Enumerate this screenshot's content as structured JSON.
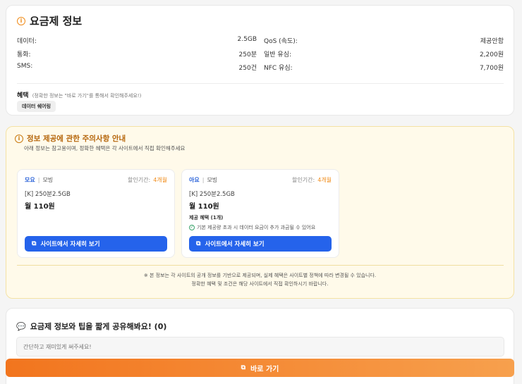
{
  "plan": {
    "title": "요금제 정보",
    "rows": [
      {
        "label": "데이터:",
        "value": "2.5GB"
      },
      {
        "label": "QoS (속도):",
        "value": "제공안함"
      },
      {
        "label": "통화:",
        "value": "250분"
      },
      {
        "label": "일반 유심:",
        "value": "2,200원"
      },
      {
        "label": "SMS:",
        "value": "250건"
      },
      {
        "label": "NFC 유심:",
        "value": "7,700원"
      }
    ],
    "benefit_label": "혜택",
    "benefit_note": "(정확한 정보는 \"바로 가기\"를 통해서 확인해주세요!)",
    "tag": "데이터 쉐어링"
  },
  "notice": {
    "title": "정보 제공에 관한 주의사항 안내",
    "subtitle": "아래 정보는 참고용이며, 정확한 혜택은 각 사이트에서 직접 확인해주세요",
    "offers": [
      {
        "brand": "모요",
        "network": "모빙",
        "discount_label": "할인기간:",
        "discount_value": "4개월",
        "name": "[K] 250분2.5GB",
        "price": "월 110원",
        "benefits_label": "",
        "benefit_item": "",
        "button": "사이트에서 자세히 보기"
      },
      {
        "brand": "아요",
        "network": "모빙",
        "discount_label": "할인기간:",
        "discount_value": "4개월",
        "name": "[K] 250분2.5GB",
        "price": "월 110원",
        "benefits_label": "제공 혜택 (1개)",
        "benefit_item": "기본 제공량 초과 시 데이터 요금이 추가 과금될 수 있어요",
        "button": "사이트에서 자세히 보기"
      }
    ],
    "footer_line1": "※ 본 정보는 각 사이트의 공개 정보를 기반으로 제공되며, 실제 혜택은 사이트별 정책에 따라 변경될 수 있습니다.",
    "footer_line2": "정확한 혜택 및 조건은 해당 사이트에서 직접 확인하시기 바랍니다."
  },
  "share": {
    "title": "요금제 정보와 팁을 짧게 공유해봐요! (0)",
    "placeholder": "간단하고 재미있게 써주세요!"
  },
  "go_button": "바로 가기",
  "colors": {
    "accent_orange": "#f2751e",
    "button_blue": "#2563eb",
    "notice_bg": "#fffaea"
  }
}
